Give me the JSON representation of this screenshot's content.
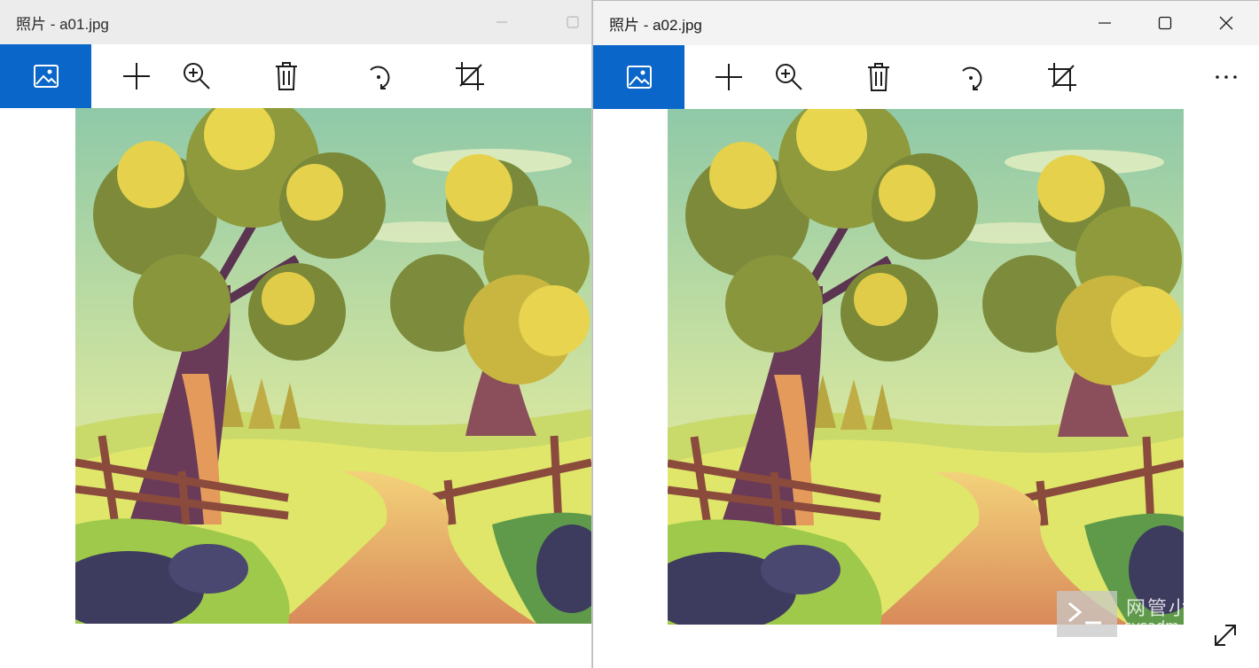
{
  "windows": [
    {
      "title": "照片 - a01.jpg",
      "controls": [
        "minimize-icon",
        "maximize-icon"
      ],
      "toolbar": [
        "image-icon",
        "add-icon",
        "zoom-in-icon",
        "delete-icon",
        "rotate-icon",
        "crop-icon"
      ]
    },
    {
      "title": "照片 - a02.jpg",
      "controls": [
        "minimize-icon",
        "maximize-icon",
        "close-icon"
      ],
      "toolbar": [
        "image-icon",
        "add-icon",
        "zoom-in-icon",
        "delete-icon",
        "rotate-icon",
        "crop-icon",
        "more-icon"
      ]
    }
  ],
  "overlay": {
    "watermark_cn": "网管小贾",
    "watermark_url": "sysadm.cc",
    "fullscreen_icon": "expand-icon"
  },
  "colors": {
    "accent": "#0a66c9",
    "titlebar_bg": "#f3f3f3",
    "desktop": "#4f6fa8"
  }
}
